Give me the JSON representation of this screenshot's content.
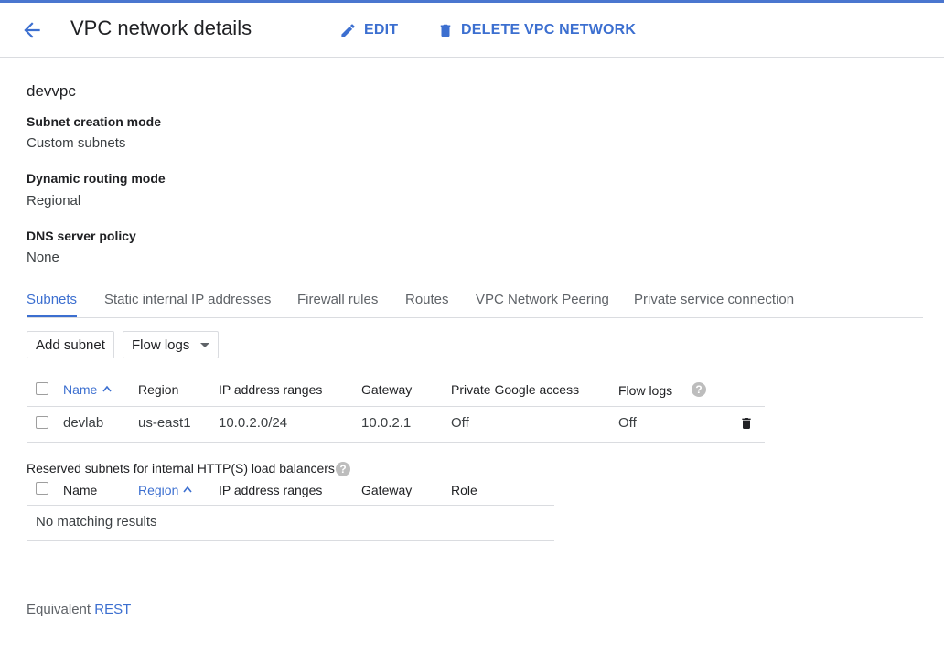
{
  "header": {
    "title": "VPC network details",
    "edit_label": "EDIT",
    "delete_label": "DELETE VPC NETWORK"
  },
  "network": {
    "name": "devvpc",
    "properties": [
      {
        "label": "Subnet creation mode",
        "value": "Custom subnets"
      },
      {
        "label": "Dynamic routing mode",
        "value": "Regional"
      },
      {
        "label": "DNS server policy",
        "value": "None"
      }
    ]
  },
  "tabs": [
    {
      "label": "Subnets",
      "active": true
    },
    {
      "label": "Static internal IP addresses",
      "active": false
    },
    {
      "label": "Firewall rules",
      "active": false
    },
    {
      "label": "Routes",
      "active": false
    },
    {
      "label": "VPC Network Peering",
      "active": false
    },
    {
      "label": "Private service connection",
      "active": false
    }
  ],
  "toolbar": {
    "add_subnet_label": "Add subnet",
    "flow_logs_label": "Flow logs"
  },
  "subnets_table": {
    "columns": [
      "Name",
      "Region",
      "IP address ranges",
      "Gateway",
      "Private Google access",
      "Flow logs"
    ],
    "sorted_column": "Name",
    "rows": [
      {
        "name": "devlab",
        "region": "us-east1",
        "ip_range": "10.0.2.0/24",
        "gateway": "10.0.2.1",
        "private_google_access": "Off",
        "flow_logs": "Off"
      }
    ]
  },
  "reserved_table": {
    "title": "Reserved subnets for internal HTTP(S) load balancers",
    "columns": [
      "Name",
      "Region",
      "IP address ranges",
      "Gateway",
      "Role"
    ],
    "sorted_column": "Region",
    "empty_message": "No matching results"
  },
  "footer": {
    "prefix": "Equivalent",
    "link_label": "REST"
  },
  "colors": {
    "accent": "#3c6fd0",
    "top_bar": "#4a76cf",
    "divider": "#dadce0"
  },
  "icons": [
    "back-arrow-icon",
    "pencil-icon",
    "trash-icon",
    "sort-up-icon",
    "help-icon",
    "dropdown-caret-icon"
  ]
}
